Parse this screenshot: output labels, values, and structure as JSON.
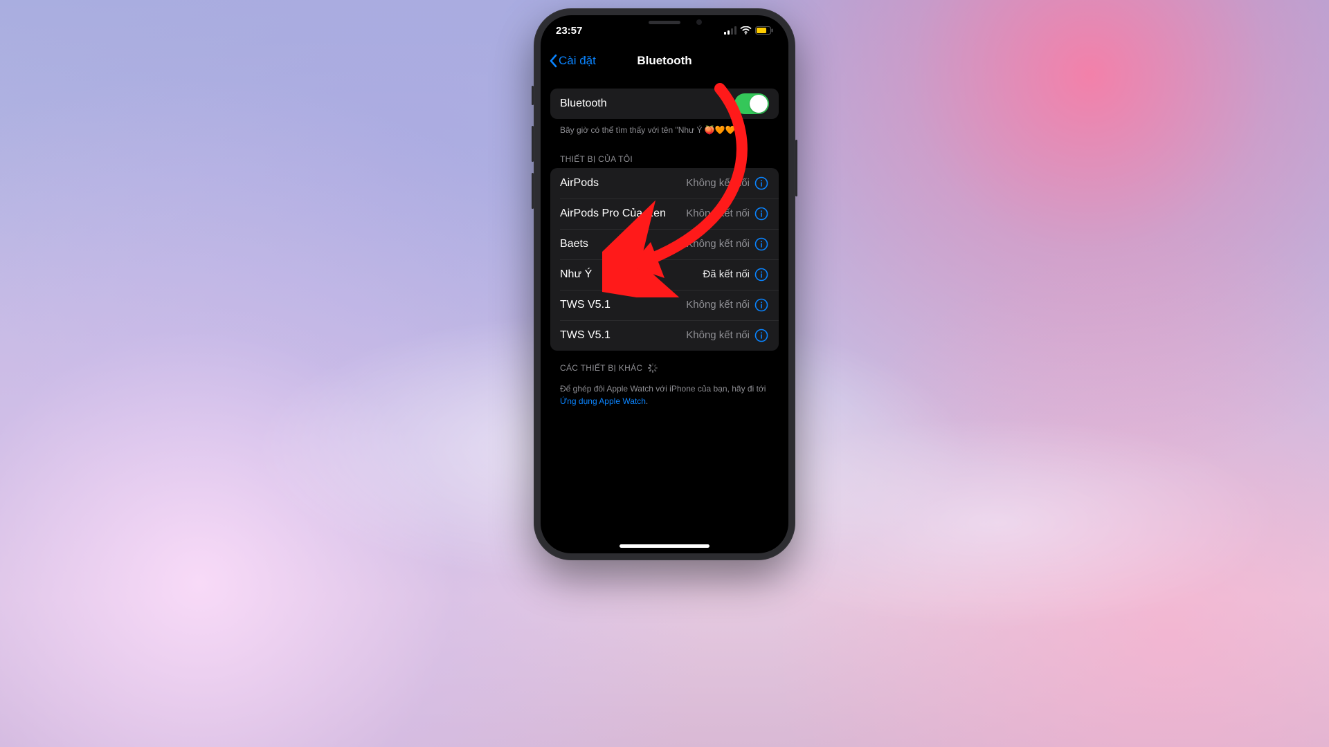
{
  "statusbar": {
    "time": "23:57"
  },
  "navbar": {
    "back_label": "Cài đặt",
    "title": "Bluetooth"
  },
  "bluetooth": {
    "label": "Bluetooth",
    "on": true,
    "discoverable_caption": "Bây giờ có thể tìm thấy với tên \"Như Ý 🍑🧡🧡\"."
  },
  "my_devices": {
    "header": "THIẾT BỊ CỦA TÔI",
    "items": [
      {
        "name": "AirPods",
        "status": "Không kết nối",
        "connected": false
      },
      {
        "name": "AirPods Pro Của Ren",
        "status": "Không kết nối",
        "connected": false
      },
      {
        "name": "Baets",
        "status": "Không kết nối",
        "connected": false
      },
      {
        "name": "Như Ý",
        "status": "Đã kết nối",
        "connected": true
      },
      {
        "name": "TWS V5.1",
        "status": "Không kết nối",
        "connected": false
      },
      {
        "name": "TWS V5.1",
        "status": "Không kết nối",
        "connected": false
      }
    ]
  },
  "other_devices": {
    "header": "CÁC THIẾT BỊ KHÁC"
  },
  "footer": {
    "text_prefix": "Để ghép đôi Apple Watch với iPhone của bạn, hãy đi tới ",
    "link_text": "Ứng dụng Apple Watch",
    "text_suffix": "."
  },
  "colors": {
    "accent": "#0a84ff",
    "switch_on": "#34c759",
    "arrow": "#ff1a1a"
  }
}
